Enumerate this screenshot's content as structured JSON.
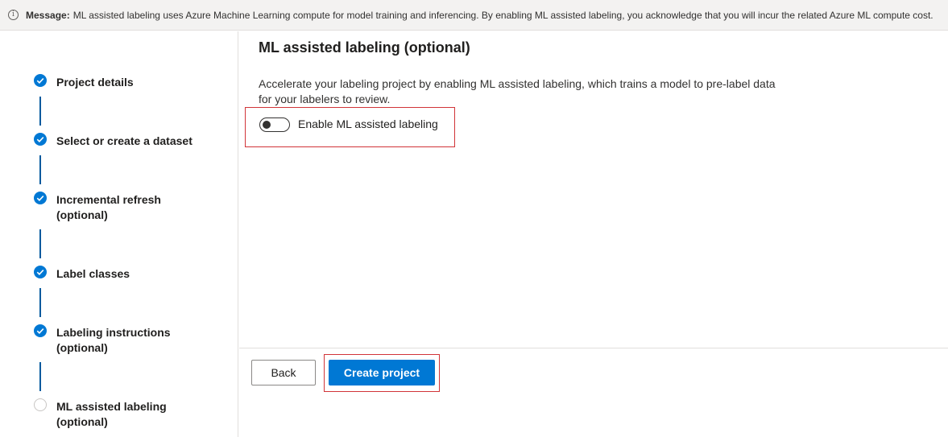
{
  "message": {
    "label": "Message:",
    "text": "ML assisted labeling uses Azure Machine Learning compute for model training and inferencing. By enabling ML assisted labeling, you acknowledge that you will incur the related Azure ML compute cost.",
    "icon": "info-icon"
  },
  "steps": [
    {
      "label_line1": "Project details",
      "label_line2": "",
      "status": "completed"
    },
    {
      "label_line1": "Select or create a dataset",
      "label_line2": "",
      "status": "completed"
    },
    {
      "label_line1": "Incremental refresh",
      "label_line2": "(optional)",
      "status": "completed"
    },
    {
      "label_line1": "Label classes",
      "label_line2": "",
      "status": "completed"
    },
    {
      "label_line1": "Labeling instructions",
      "label_line2": "(optional)",
      "status": "completed"
    },
    {
      "label_line1": "ML assisted labeling",
      "label_line2": "(optional)",
      "status": "current"
    }
  ],
  "main": {
    "title": "ML assisted labeling (optional)",
    "description": "Accelerate your labeling project by enabling ML assisted labeling, which trains a model to pre-label data for your labelers to review.",
    "toggle_label": "Enable ML assisted labeling",
    "toggle_on": false
  },
  "footer": {
    "back_label": "Back",
    "create_label": "Create project"
  },
  "colors": {
    "accent": "#0078d4",
    "highlight_border": "#d13438"
  }
}
